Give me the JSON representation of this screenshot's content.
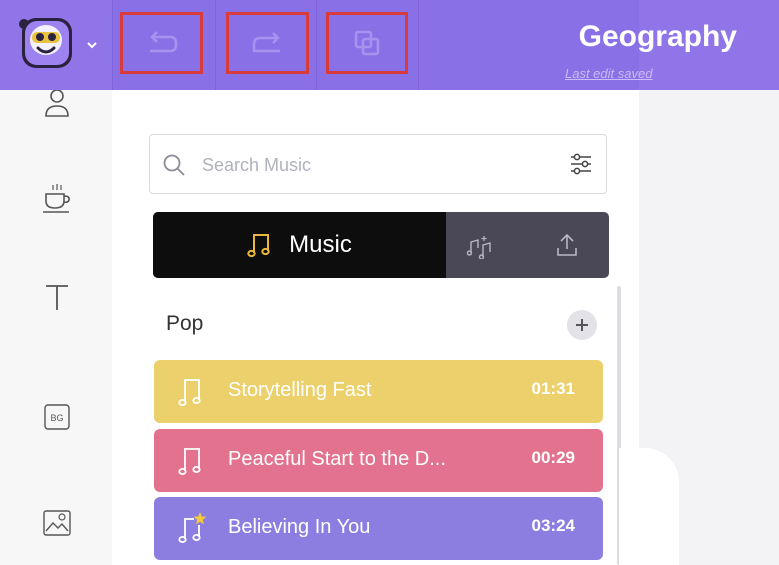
{
  "header": {
    "title": "Geography",
    "save_status": "Last edit saved",
    "background_color": "#8f75e8",
    "toolbar": {
      "undo_icon": "undo-arrow-icon",
      "redo_icon": "redo-arrow-icon",
      "duplicate_icon": "duplicate-icon",
      "highlight_color": "#d73b3b"
    },
    "logo_icon": "robot-mascot-icon"
  },
  "sidebar": {
    "items": [
      {
        "name": "characters",
        "icon": "person-icon"
      },
      {
        "name": "props",
        "icon": "coffee-cup-icon"
      },
      {
        "name": "text",
        "icon": "text-T-icon"
      },
      {
        "name": "backgrounds",
        "icon": "bg-icon",
        "label": "BG"
      },
      {
        "name": "images",
        "icon": "image-icon"
      }
    ]
  },
  "music_panel": {
    "search": {
      "placeholder": "Search Music",
      "value": ""
    },
    "tabs": [
      {
        "label": "Music",
        "icon": "music-note-icon",
        "active": true
      },
      {
        "label": "",
        "icon": "sound-effects-icon",
        "active": false
      },
      {
        "label": "",
        "icon": "upload-icon",
        "active": false
      }
    ],
    "category": "Pop",
    "tracks": [
      {
        "name": "Storytelling Fast",
        "duration": "01:31",
        "color": "#ebd06b",
        "icon": "music-note-icon"
      },
      {
        "name": "Peaceful Start to the D...",
        "duration": "00:29",
        "color": "#e3728e",
        "icon": "music-note-icon"
      },
      {
        "name": "Believing In You",
        "duration": "03:24",
        "color": "#8c7ee1",
        "icon": "premium-music-note-icon"
      }
    ]
  }
}
